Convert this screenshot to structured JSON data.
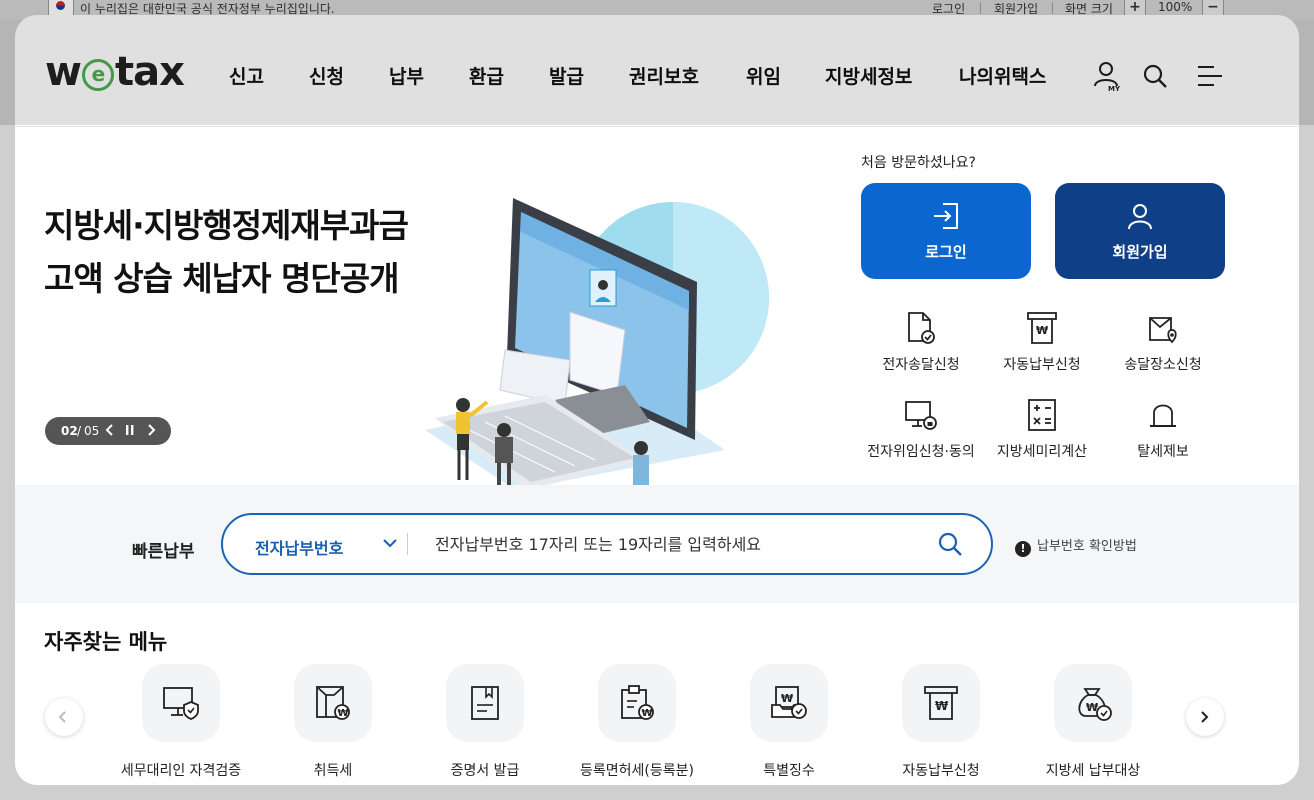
{
  "gov_banner": {
    "text": "이 누리집은 대한민국 공식 전자정부 누리집입니다.",
    "login": "로그인",
    "signup": "회원가입",
    "zoom_label": "화면 크기",
    "zoom_plus": "+",
    "zoom_value": "100%",
    "zoom_minus": "−"
  },
  "header": {
    "logo_w": "w",
    "logo_e": "e",
    "logo_tax": "tax",
    "nav": [
      "신고",
      "신청",
      "납부",
      "환급",
      "발급",
      "권리보호",
      "위임",
      "지방세정보",
      "나의위택스"
    ],
    "my_icon_label": "MY"
  },
  "hero": {
    "title_line1": "지방세·지방행정제재부과금",
    "title_line2": "고액 상습 체납자 명단공개",
    "pager_current": "02",
    "pager_sep": "/",
    "pager_total": "05"
  },
  "side": {
    "first_visit": "처음 방문하셨나요?",
    "login_label": "로그인",
    "signup_label": "회원가입",
    "quick_items": [
      "전자송달신청",
      "자동납부신청",
      "송달장소신청",
      "전자위임신청·동의",
      "지방세미리계산",
      "탈세제보"
    ],
    "colors": {
      "login": "#0b66d0",
      "signup": "#0f3f86"
    }
  },
  "quick_pay": {
    "title": "빠른납부",
    "select_value": "전자납부번호",
    "placeholder": "전자납부번호 17자리 또는 19자리를 입력하세요",
    "help": "납부번호 확인방법"
  },
  "frequent": {
    "title": "자주찾는 메뉴",
    "items": [
      "세무대리인 자격검증",
      "취득세",
      "증명서 발급",
      "등록면허세(등록분)",
      "특별징수",
      "자동납부신청",
      "지방세 납부대상"
    ]
  }
}
